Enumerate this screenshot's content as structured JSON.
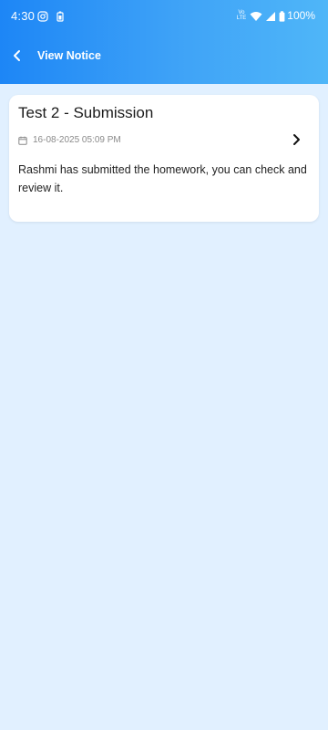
{
  "status_bar": {
    "time": "4:30",
    "icons": [
      "instagram-icon",
      "battery-saver-icon",
      "volte-icon",
      "wifi-icon",
      "signal-icon",
      "battery-icon"
    ],
    "network_text": "Vo LTE",
    "battery": "100%"
  },
  "header": {
    "back_icon": "back-arrow-icon",
    "title": "View Notice"
  },
  "notice": {
    "title": "Test 2 - Submission",
    "date_icon": "calendar-icon",
    "datetime": "16-08-2025 05:09 PM",
    "action_icon": "chevron-right-icon",
    "message": "Rashmi has submitted the homework, you can check and review it."
  },
  "colors": {
    "header_gradient_start": "#1d86f6",
    "header_gradient_end": "#4fb6f8",
    "background": "#e1f0ff",
    "card_background": "#ffffff"
  }
}
